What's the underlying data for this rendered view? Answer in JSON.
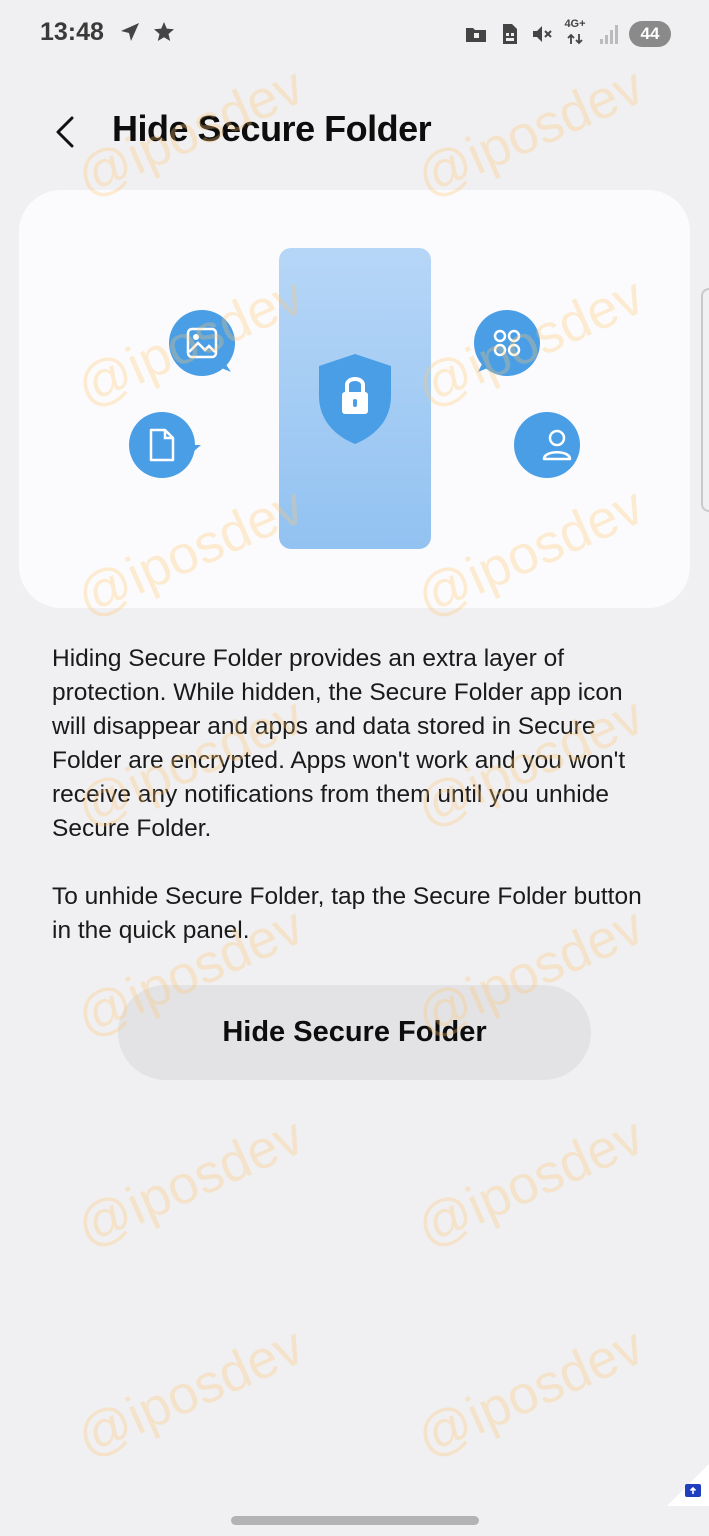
{
  "status_bar": {
    "time": "13:48",
    "left_icons": [
      "navigation-icon",
      "star-icon"
    ],
    "right_icons": [
      "folder-icon",
      "sim-icon",
      "mute-icon",
      "signal-icon"
    ],
    "network": "4G+",
    "battery": "44"
  },
  "header": {
    "title": "Hide Secure Folder"
  },
  "illustration": {
    "icons": [
      "image-icon",
      "document-icon",
      "apps-grid-icon",
      "person-icon",
      "shield-lock-icon"
    ],
    "accent_color": "#4a9ee6",
    "phone_gradient": [
      "#b6d6f7",
      "#92c2f1"
    ]
  },
  "content": {
    "paragraph1": "Hiding Secure Folder provides an extra layer of protection. While hidden, the Secure Folder app icon will disappear and apps and data stored in Secure Folder are encrypted. Apps won't work and you won't receive any notifications from them until you unhide Secure Folder.",
    "paragraph2": "To unhide Secure Folder, tap the Secure Folder button in the quick panel."
  },
  "action": {
    "button_label": "Hide Secure Folder"
  },
  "watermark": "@iposdev"
}
